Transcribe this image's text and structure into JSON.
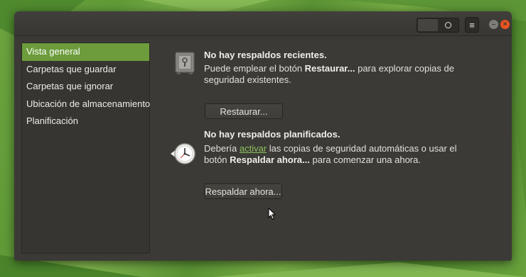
{
  "window": {
    "title_switch_state": "off",
    "menu_icon": "hamburger-menu-icon",
    "minimize_glyph": "–",
    "close_glyph": "×"
  },
  "sidebar": {
    "items": [
      {
        "label": "Vista general",
        "active": true
      },
      {
        "label": "Carpetas que guardar",
        "active": false
      },
      {
        "label": "Carpetas que ignorar",
        "active": false
      },
      {
        "label": "Ubicación de almacenamiento",
        "active": false
      },
      {
        "label": "Planificación",
        "active": false
      }
    ]
  },
  "overview": {
    "restore": {
      "icon": "safe-icon",
      "title": "No hay respaldos recientes.",
      "desc_pre": "Puede emplear el botón ",
      "desc_bold": "Restaurar...",
      "desc_post": " para explorar copias de seguridad existentes.",
      "button": "Restaurar..."
    },
    "backup": {
      "icon": "clock-icon",
      "title": "No hay respaldos planificados.",
      "desc_pre": "Debería ",
      "desc_link": "activar",
      "desc_mid": " las copias de seguridad automáticas o usar el botón ",
      "desc_bold": "Respaldar ahora...",
      "desc_post": " para comenzar una ahora.",
      "button": "Respaldar ahora..."
    }
  },
  "colors": {
    "accent": "#6c9c3c",
    "link": "#8ec25b",
    "close": "#e95420",
    "window_bg": "#3b3a36"
  }
}
